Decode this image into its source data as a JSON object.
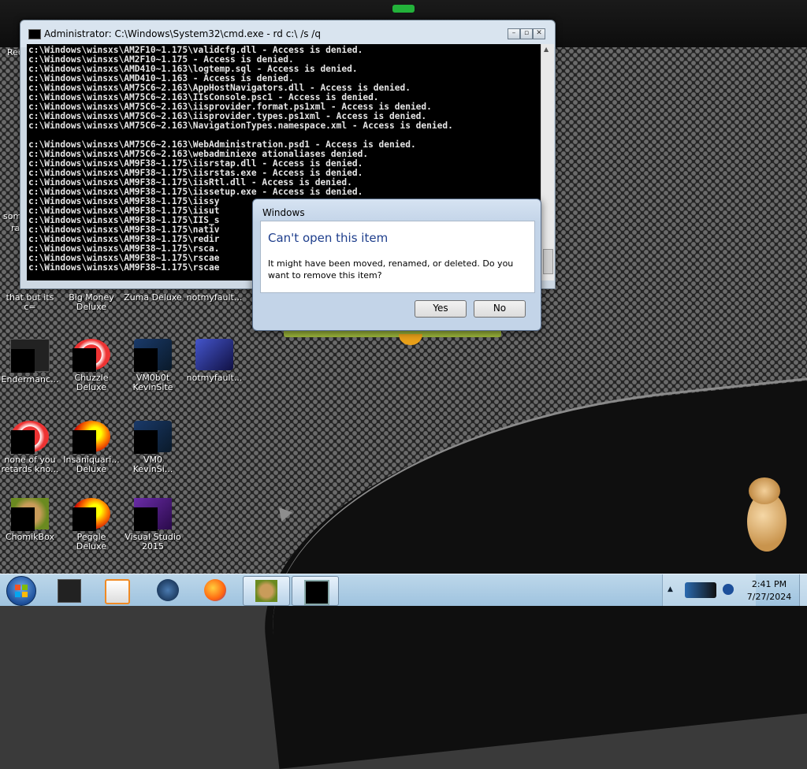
{
  "cmd_window": {
    "title": "Administrator: C:\\Windows\\System32\\cmd.exe - rd  c:\\ /s /q",
    "lines": [
      "c:\\Windows\\winsxs\\AM2F10~1.175\\validcfg.dll - Access is denied.",
      "c:\\Windows\\winsxs\\AM2F10~1.175 - Access is denied.",
      "c:\\Windows\\winsxs\\AMD410~1.163\\logtemp.sql - Access is denied.",
      "c:\\Windows\\winsxs\\AMD410~1.163 - Access is denied.",
      "c:\\Windows\\winsxs\\AM75C6~2.163\\AppHostNavigators.dll - Access is denied.",
      "c:\\Windows\\winsxs\\AM75C6~2.163\\IIsConsole.psc1 - Access is denied.",
      "c:\\Windows\\winsxs\\AM75C6~2.163\\iisprovider.format.ps1xml - Access is denied.",
      "c:\\Windows\\winsxs\\AM75C6~2.163\\iisprovider.types.ps1xml - Access is denied.",
      "c:\\Windows\\winsxs\\AM75C6~2.163\\NavigationTypes.namespace.xml - Access is denied.",
      "",
      "c:\\Windows\\winsxs\\AM75C6~2.163\\WebAdministration.psd1 - Access is denied.",
      "c:\\Windows\\winsxs\\AM75C6~2.163\\webadminiexe ationaliases denied.",
      "c:\\Windows\\winsxs\\AM9F38~1.175\\iisrstap.dll - Access is denied.",
      "c:\\Windows\\winsxs\\AM9F38~1.175\\iisrstas.exe - Access is denied.",
      "c:\\Windows\\winsxs\\AM9F38~1.175\\iisRtl.dll - Access is denied.",
      "c:\\Windows\\winsxs\\AM9F38~1.175\\iissetup.exe - Access is denied.",
      "c:\\Windows\\winsxs\\AM9F38~1.175\\iissy",
      "c:\\Windows\\winsxs\\AM9F38~1.175\\iisut",
      "c:\\Windows\\winsxs\\AM9F38~1.175\\IIS_s",
      "c:\\Windows\\winsxs\\AM9F38~1.175\\nativ",
      "c:\\Windows\\winsxs\\AM9F38~1.175\\redir",
      "c:\\Windows\\winsxs\\AM9F38~1.175\\rsca.",
      "c:\\Windows\\winsxs\\AM9F38~1.175\\rscae",
      "c:\\Windows\\winsxs\\AM9F38~1.175\\rscae"
    ]
  },
  "dialog": {
    "title": "Windows",
    "heading": "Can't open this item",
    "message": "It might have been moved, renamed, or deleted. Do you want to remove this item?",
    "yes_label": "Yes",
    "no_label": "No"
  },
  "desktop": {
    "partial_labels": [
      "Rec",
      "som",
      "ra"
    ],
    "icons_row1": [
      "that but its c=",
      "Big Money Deluxe",
      "Zuma Deluxe",
      "notmyfault..."
    ],
    "icons_row2": [
      "Endermanc...",
      "Chuzzle Deluxe",
      "VM0b0t KevinSite",
      "notmyfault..."
    ],
    "icons_row3": [
      "none of you retards kno...",
      "Insaniquari... Deluxe",
      "VM0 KevinSi..."
    ],
    "icons_row4": [
      "ChomikBox",
      "Peggle Deluxe",
      "Visual Studio 2015"
    ]
  },
  "taskbar": {
    "time": "2:41 PM",
    "date": "7/27/2024"
  }
}
